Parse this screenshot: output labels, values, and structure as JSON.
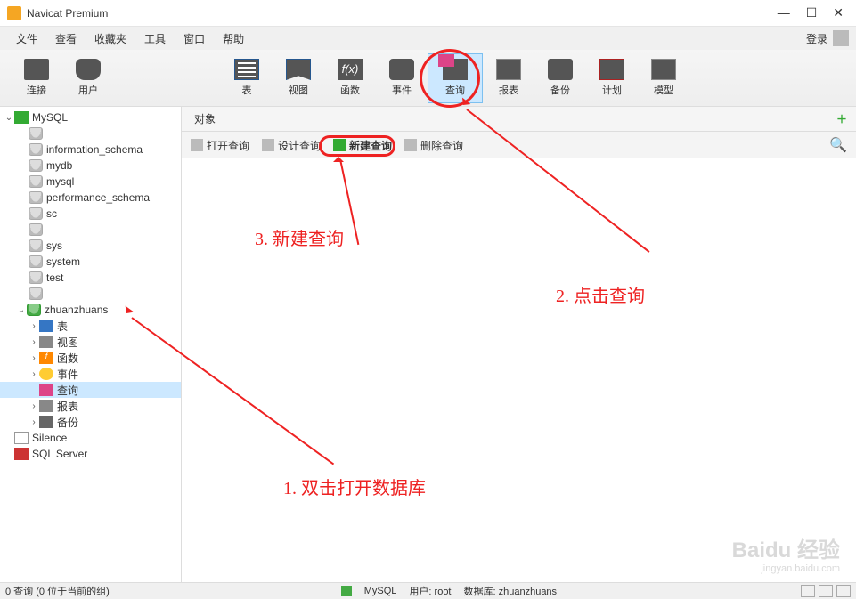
{
  "window": {
    "title": "Navicat Premium"
  },
  "menubar": {
    "items": [
      "文件",
      "查看",
      "收藏夹",
      "工具",
      "窗口",
      "帮助"
    ],
    "login": "登录"
  },
  "toolbar": {
    "connect": "连接",
    "user": "用户",
    "table": "表",
    "view": "视图",
    "function": "函数",
    "function_symbol": "f(x)",
    "event": "事件",
    "query": "查询",
    "report": "报表",
    "backup": "备份",
    "plan": "计划",
    "model": "模型"
  },
  "sidebar": {
    "conn_mysql": "MySQL",
    "databases": [
      "information_schema",
      "mydb",
      "mysql",
      "performance_schema",
      "sc",
      "",
      "sys",
      "system",
      "test",
      ""
    ],
    "open_db": "zhuanzhuans",
    "open_db_nodes": {
      "table": "表",
      "view": "视图",
      "function": "函数",
      "event": "事件",
      "query": "查询",
      "report": "报表",
      "backup": "备份"
    },
    "conn_silence": "Silence",
    "conn_sqlserver": "SQL Server"
  },
  "tabs": {
    "objects": "对象"
  },
  "subtoolbar": {
    "open_query": "打开查询",
    "design_query": "设计查询",
    "new_query": "新建查询",
    "delete_query": "删除查询"
  },
  "annotations": {
    "a1": "1. 双击打开数据库",
    "a2": "2. 点击查询",
    "a3": "3. 新建查询"
  },
  "statusbar": {
    "left": "0 查询 (0 位于当前的组)",
    "conn": "MySQL",
    "user_label": "用户: root",
    "db_label": "数据库: zhuanzhuans"
  },
  "watermark": {
    "brand": "Baidu 经验",
    "url": "jingyan.baidu.com"
  }
}
